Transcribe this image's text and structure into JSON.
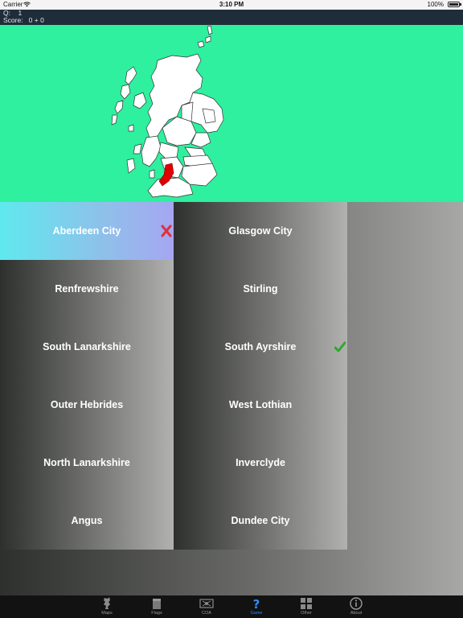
{
  "status_bar": {
    "carrier": "Carrier",
    "time": "3:10 PM",
    "battery": "100%"
  },
  "info": {
    "question_label": "Q:",
    "question_number": "1",
    "score_label": "Score:",
    "score_value": "0 + 0"
  },
  "map": {
    "background_color": "#2ef09f",
    "highlight_color": "#e00000",
    "region_fill": "#ffffff"
  },
  "answers": [
    {
      "label": "Aberdeen City",
      "state": "wrong",
      "mark": "cross-icon"
    },
    {
      "label": "Glasgow City",
      "state": "normal"
    },
    {
      "label": "Renfrewshire",
      "state": "normal"
    },
    {
      "label": "Stirling",
      "state": "normal"
    },
    {
      "label": "South Lanarkshire",
      "state": "normal"
    },
    {
      "label": "South Ayrshire",
      "state": "correct",
      "mark": "check-icon"
    },
    {
      "label": "Outer Hebrides",
      "state": "normal"
    },
    {
      "label": "West Lothian",
      "state": "normal"
    },
    {
      "label": "North Lanarkshire",
      "state": "normal"
    },
    {
      "label": "Inverclyde",
      "state": "normal"
    },
    {
      "label": "Angus",
      "state": "normal"
    },
    {
      "label": "Dundee City",
      "state": "normal"
    }
  ],
  "tabs": [
    {
      "label": "Maps",
      "icon": "map-icon",
      "active": false
    },
    {
      "label": "Flags",
      "icon": "flag-icon",
      "active": false
    },
    {
      "label": "COA",
      "icon": "coat-of-arms-icon",
      "active": false
    },
    {
      "label": "Game",
      "icon": "question-icon",
      "active": true
    },
    {
      "label": "Other",
      "icon": "grid-icon",
      "active": false
    },
    {
      "label": "About",
      "icon": "info-icon",
      "active": false
    }
  ],
  "colors": {
    "accent": "#2f8cff",
    "wrong": "#e0303a",
    "correct": "#2ea82e"
  }
}
